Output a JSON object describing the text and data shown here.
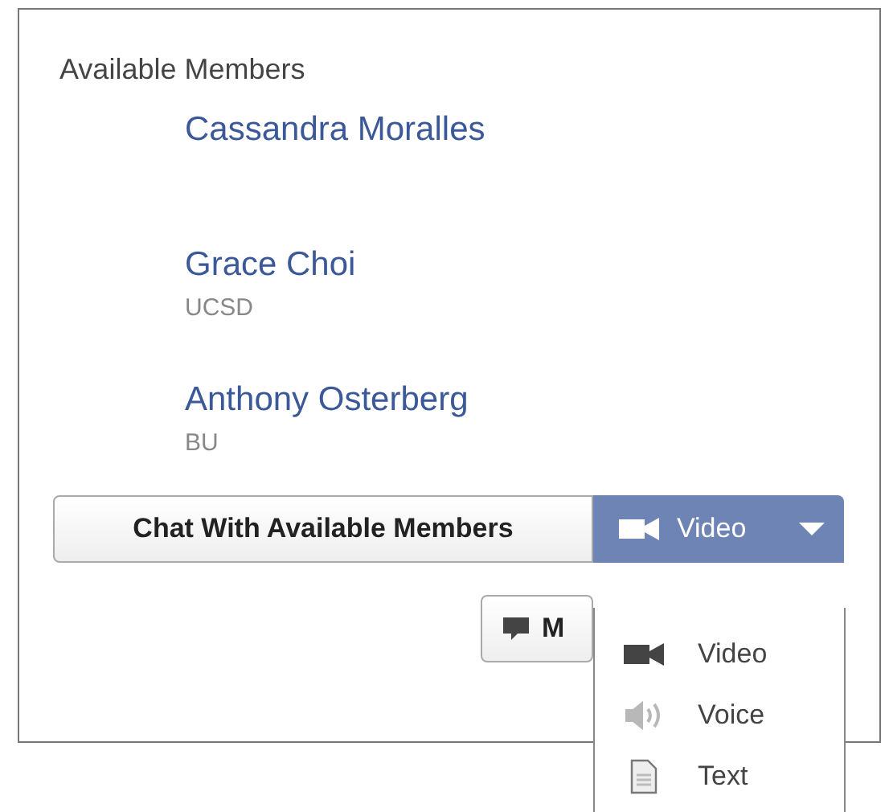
{
  "title": "Available Members",
  "members": [
    {
      "name": "Cassandra Moralles"
    },
    {
      "name": "Grace Choi",
      "affiliation": "UCSD"
    },
    {
      "name": "Anthony Osterberg",
      "affiliation": "BU"
    }
  ],
  "chat_button": {
    "label": "Chat With Available Members"
  },
  "mode_dropdown": {
    "label": "Video",
    "kind": "video",
    "expanded": true
  },
  "mode_options": [
    {
      "kind": "video",
      "label": "Video"
    },
    {
      "kind": "voice",
      "label": "Voice"
    },
    {
      "kind": "text",
      "label": "Text"
    }
  ],
  "message_button": {
    "label": "M"
  }
}
